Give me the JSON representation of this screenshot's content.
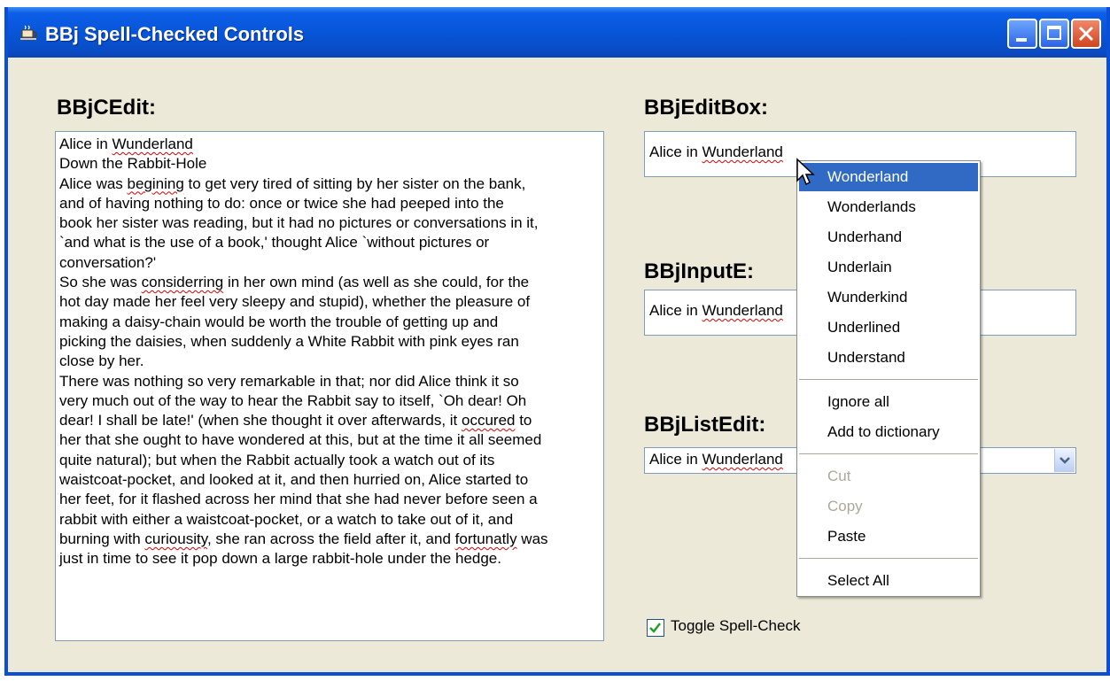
{
  "window": {
    "title": "BBj Spell-Checked Controls"
  },
  "labels": {
    "cedit": "BBjCEdit:",
    "editbox": "BBjEditBox:",
    "inpute": "BBjInputE:",
    "listedit": "BBjListEdit:"
  },
  "cedit_lines": [
    [
      "Alice in ",
      {
        "sq": "Wunderland"
      }
    ],
    [
      "Down the Rabbit-Hole"
    ],
    [
      "Alice was ",
      {
        "sq": "begining"
      },
      " to get very tired of sitting by her sister on the bank,"
    ],
    [
      "and of having nothing to do: once or twice she had peeped into the"
    ],
    [
      "book her sister was reading, but it had no pictures or conversations in it,"
    ],
    [
      "`and what is the use of a book,' thought Alice `without pictures or"
    ],
    [
      "conversation?'"
    ],
    [
      "So she was ",
      {
        "sq": "considerring"
      },
      " in her own mind (as well as she could, for the"
    ],
    [
      "hot day made her feel very sleepy and stupid), whether the pleasure of"
    ],
    [
      "making a daisy-chain would be worth the trouble of getting up and"
    ],
    [
      "picking the daisies, when suddenly a White Rabbit with pink eyes ran"
    ],
    [
      "close by her."
    ],
    [
      "There was nothing so very remarkable in that; nor did Alice think it so"
    ],
    [
      "very much out of the way to hear the Rabbit say to itself, `Oh dear! Oh"
    ],
    [
      "dear! I shall be late!' (when she thought it over afterwards, it ",
      {
        "sq": "occured"
      },
      " to"
    ],
    [
      "her that she ought to have wondered at this, but at the time it all seemed"
    ],
    [
      "quite natural); but when the Rabbit actually took a watch out of its"
    ],
    [
      "waistcoat-pocket, and looked at it, and then hurried on, Alice started to"
    ],
    [
      "her feet, for it flashed across her mind that she had never before seen a"
    ],
    [
      "rabbit with either a waistcoat-pocket, or a watch to take out of it, and"
    ],
    [
      "burning with ",
      {
        "sq": "curiousity"
      },
      ", she ran across the field after it, and ",
      {
        "sq": "fortunatly"
      },
      " was"
    ],
    [
      "just in time to see it pop down a large rabbit-hole under the hedge."
    ]
  ],
  "editbox": {
    "prefix": "Alice in ",
    "misspelled": "Wunderland"
  },
  "inpute": {
    "prefix": "Alice in ",
    "misspelled": "Wunderland"
  },
  "listedit": {
    "prefix": "Alice in ",
    "misspelled": "Wunderland"
  },
  "context_menu": {
    "suggestions": [
      "Wonderland",
      "Wonderlands",
      "Underhand",
      "Underlain",
      "Wunderkind",
      "Underlined",
      "Understand"
    ],
    "ignore_all": "Ignore all",
    "add_to_dictionary": "Add to dictionary",
    "cut": "Cut",
    "copy": "Copy",
    "paste": "Paste",
    "select_all": "Select All"
  },
  "toggle": {
    "label": "Toggle Spell-Check",
    "checked": true
  },
  "colors": {
    "titlebar": "#0754d6",
    "highlight": "#316ac5",
    "squiggle": "#dd0000"
  }
}
